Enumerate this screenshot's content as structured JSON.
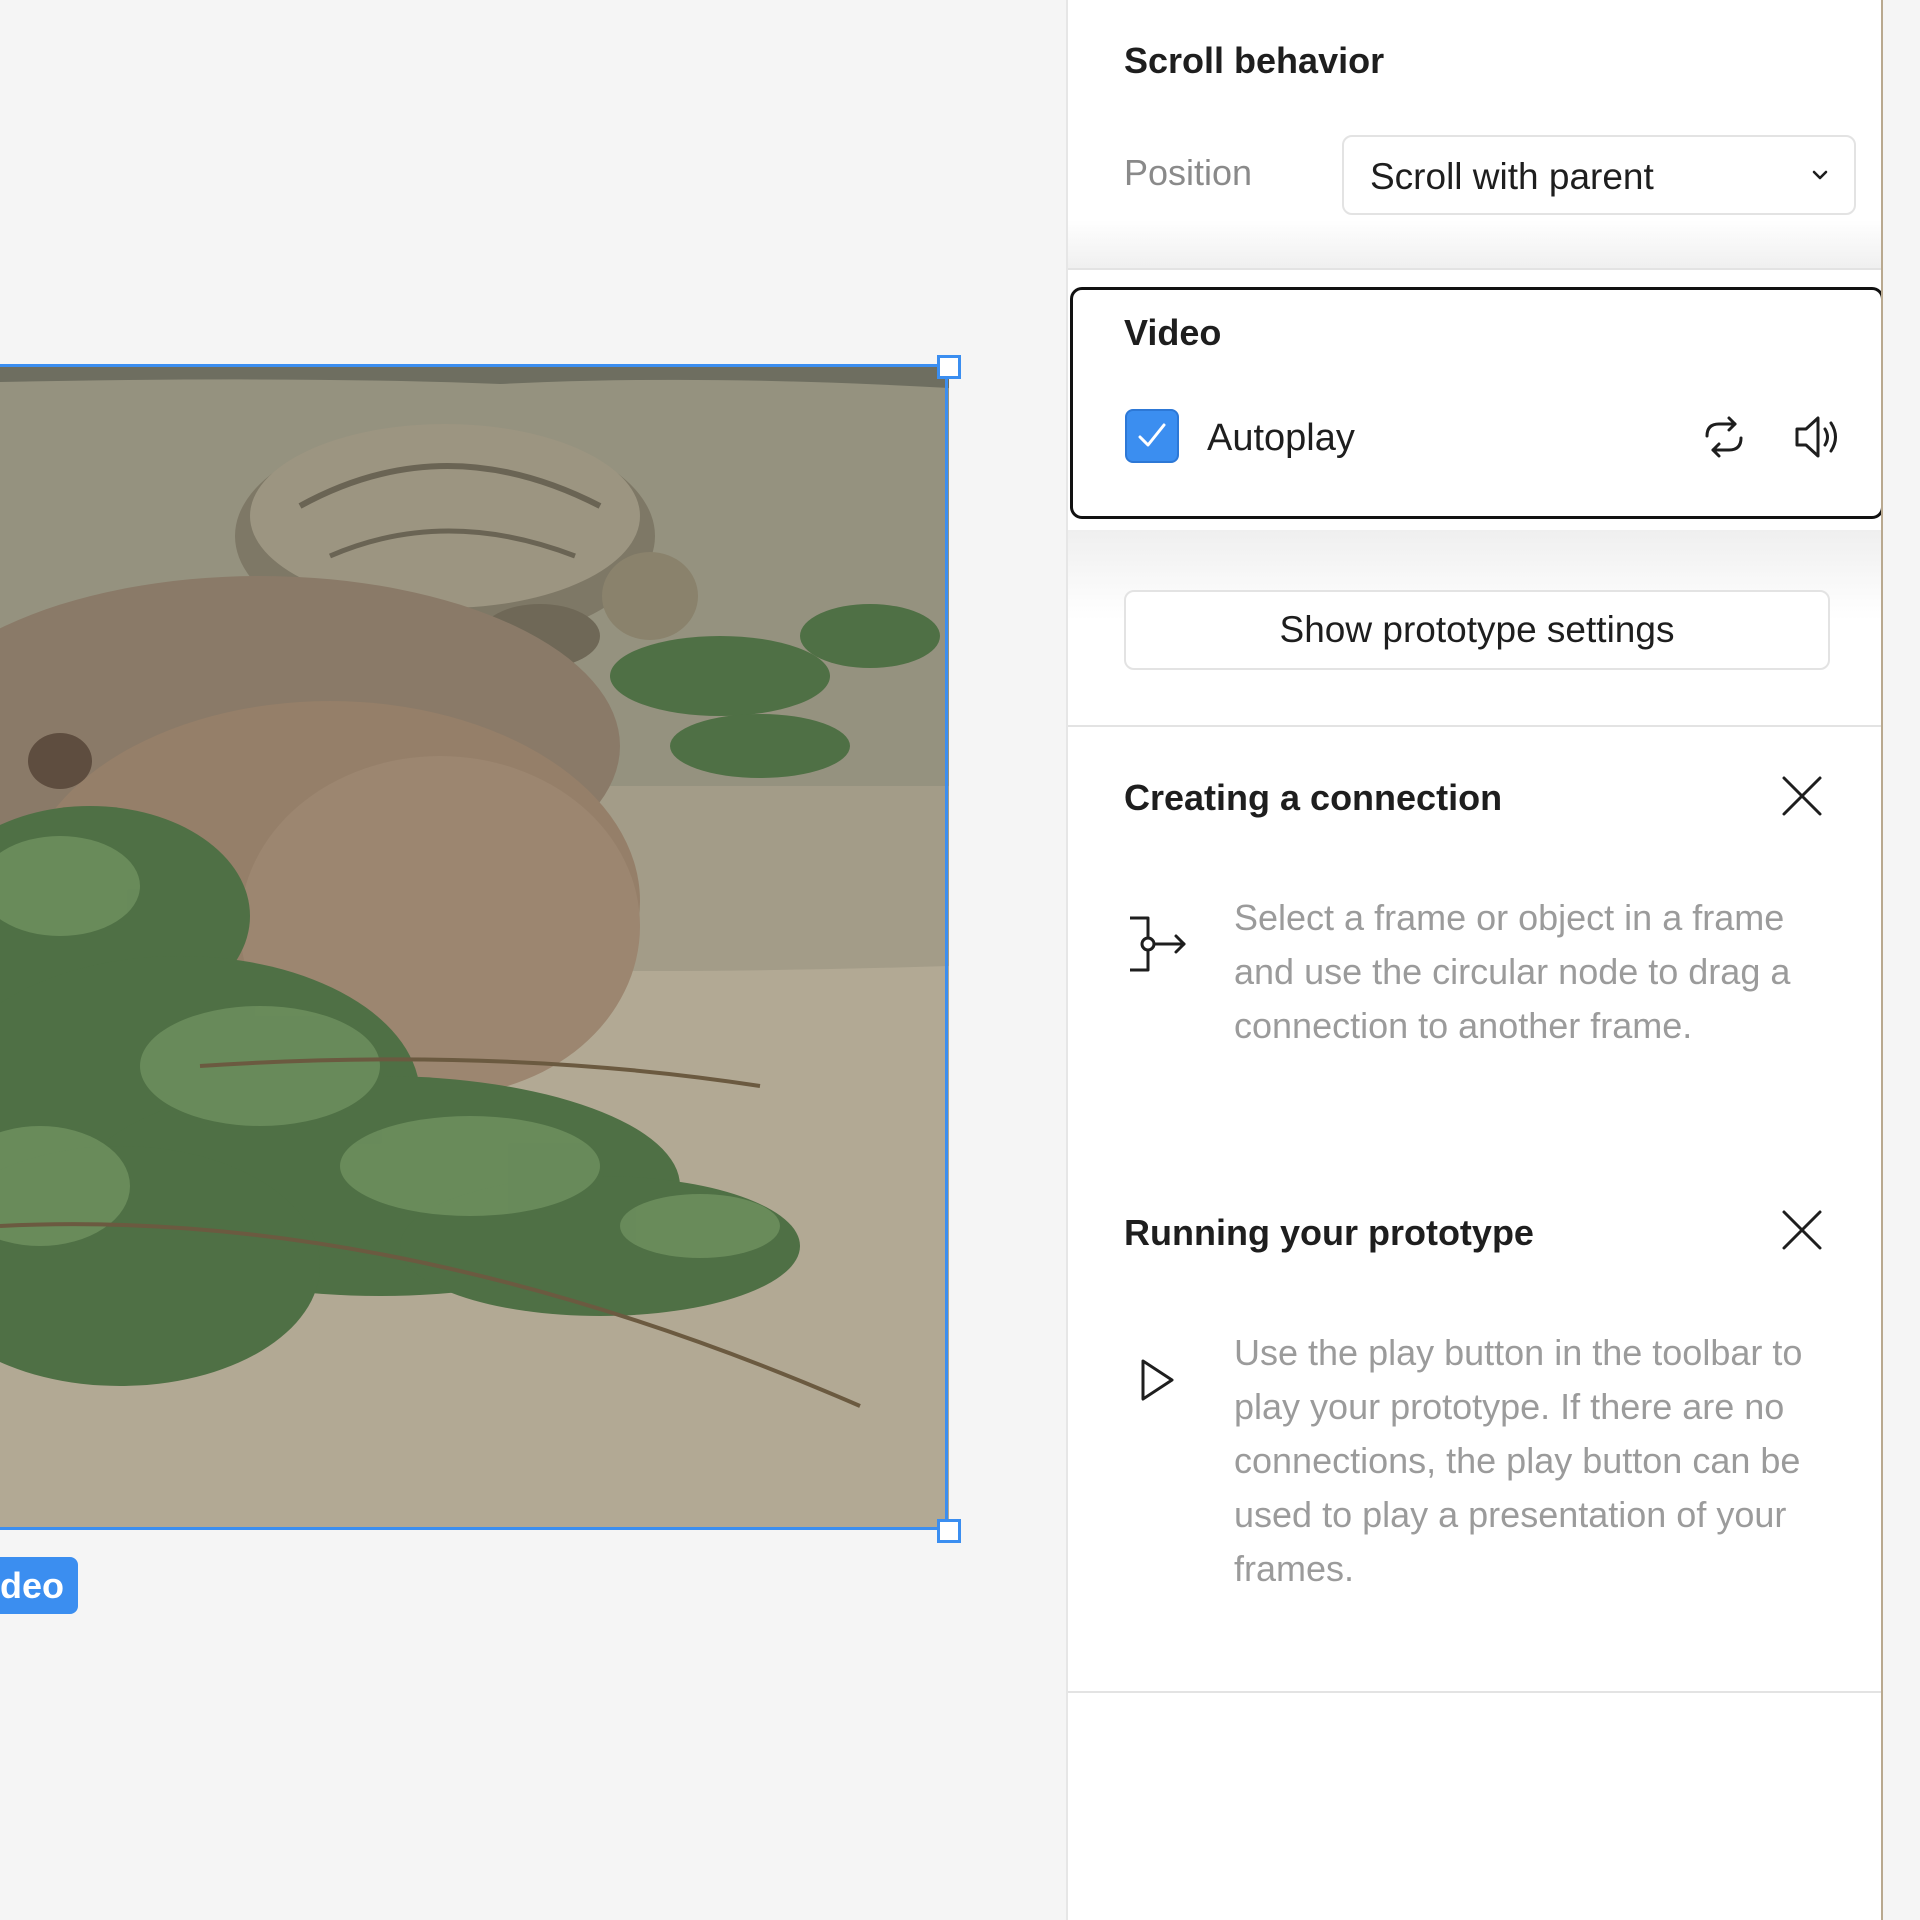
{
  "canvas": {
    "layer_label": "deo",
    "accent_color": "#3b8ef0"
  },
  "scroll_behavior": {
    "title": "Scroll behavior",
    "position_label": "Position",
    "position_value": "Scroll with parent"
  },
  "video": {
    "title": "Video",
    "autoplay_label": "Autoplay",
    "autoplay_checked": true,
    "icons": [
      "loop-icon",
      "volume-icon"
    ]
  },
  "prototype": {
    "button_label": "Show prototype settings"
  },
  "tips": [
    {
      "title": "Creating a connection",
      "icon": "connection-icon",
      "text": "Select a frame or object in a frame and use the circular node to drag a connection to another frame."
    },
    {
      "title": "Running your prototype",
      "icon": "play-icon",
      "text": "Use the play button in the toolbar to play your prototype. If there are no connections, the play button can be used to play a presentation of your frames."
    }
  ]
}
